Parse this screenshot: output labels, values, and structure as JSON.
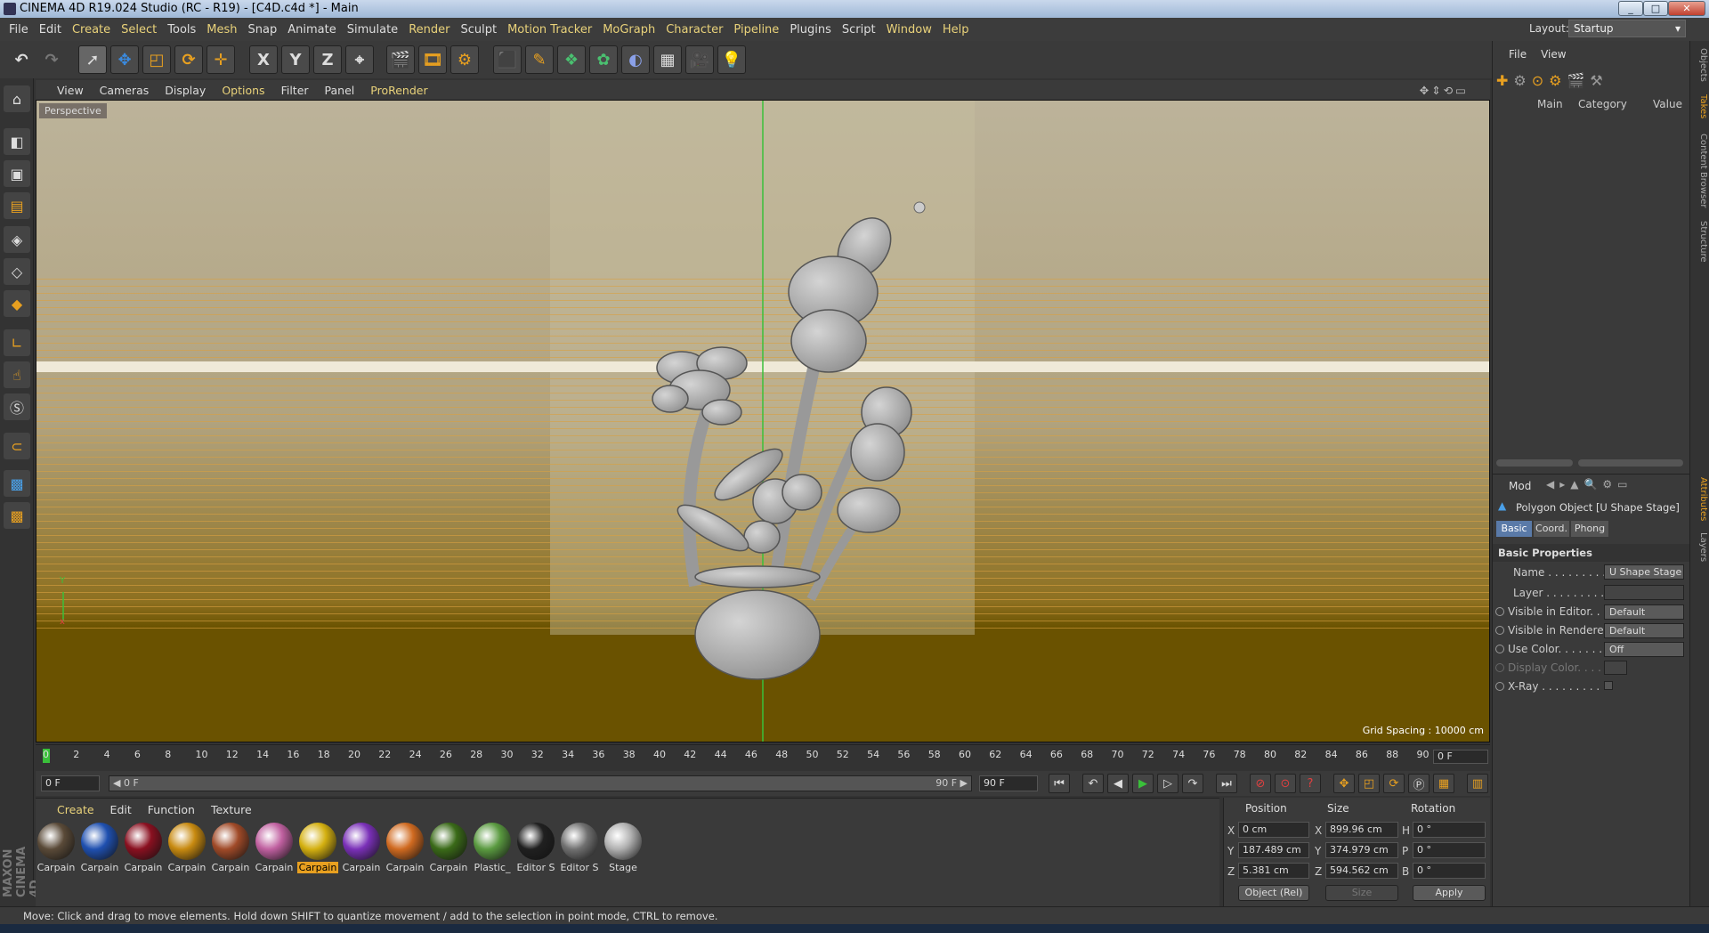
{
  "window": {
    "title": "CINEMA 4D R19.024 Studio (RC - R19) - [C4D.c4d *] - Main",
    "min": "_",
    "max": "□",
    "close": "✕"
  },
  "menu": [
    "File",
    "Edit",
    "Create",
    "Select",
    "Tools",
    "Mesh",
    "Snap",
    "Animate",
    "Simulate",
    "Render",
    "Sculpt",
    "Motion Tracker",
    "MoGraph",
    "Character",
    "Pipeline",
    "Plugins",
    "Script",
    "Window",
    "Help"
  ],
  "layout": {
    "label": "Layout:",
    "value": "Startup"
  },
  "toolbar": {
    "x": "X",
    "y": "Y",
    "z": "Z"
  },
  "viewport": {
    "menu": [
      "View",
      "Cameras",
      "Display",
      "Options",
      "Filter",
      "Panel",
      "ProRender"
    ],
    "camera_label": "Perspective",
    "grid_spacing": "Grid Spacing : 10000 cm",
    "axis_y": "Y",
    "axis_x": "x"
  },
  "timeline": {
    "ticks": [
      "0",
      "2",
      "4",
      "6",
      "8",
      "10",
      "12",
      "14",
      "16",
      "18",
      "20",
      "22",
      "24",
      "26",
      "28",
      "30",
      "32",
      "34",
      "36",
      "38",
      "40",
      "42",
      "44",
      "46",
      "48",
      "50",
      "52",
      "54",
      "56",
      "58",
      "60",
      "62",
      "64",
      "66",
      "68",
      "70",
      "72",
      "74",
      "76",
      "78",
      "80",
      "82",
      "84",
      "86",
      "88",
      "90"
    ],
    "current": "0 F"
  },
  "transport": {
    "start": "0 F",
    "range_start": "◀ 0 F",
    "range_end": "90 F ▶",
    "end": "90 F"
  },
  "materials": {
    "menu": [
      "Create",
      "Edit",
      "Function",
      "Texture"
    ],
    "items": [
      {
        "label": "Carpain",
        "color": "#5a4a38"
      },
      {
        "label": "Carpain",
        "color": "#1f50b0"
      },
      {
        "label": "Carpain",
        "color": "#8a1020"
      },
      {
        "label": "Carpain",
        "color": "#c88a10"
      },
      {
        "label": "Carpain",
        "color": "#a04a28"
      },
      {
        "label": "Carpain",
        "color": "#c060a0"
      },
      {
        "label": "Carpain",
        "color": "#d4b010",
        "selected": true
      },
      {
        "label": "Carpain",
        "color": "#7a30b8"
      },
      {
        "label": "Carpain",
        "color": "#d06a20"
      },
      {
        "label": "Carpain",
        "color": "#3a6a18"
      },
      {
        "label": "Plastic_",
        "color": "#5a9a40"
      },
      {
        "label": "Editor S",
        "color": "#202020"
      },
      {
        "label": "Editor S",
        "color": "#707070"
      },
      {
        "label": "Stage",
        "color": "#b0b0b0"
      }
    ]
  },
  "coords": {
    "headers": {
      "position": "Position",
      "size": "Size",
      "rotation": "Rotation"
    },
    "rows": [
      {
        "axis": "X",
        "pos": "0 cm",
        "saxis": "X",
        "size": "899.96 cm",
        "raxis": "H",
        "rot": "0 °"
      },
      {
        "axis": "Y",
        "pos": "187.489 cm",
        "saxis": "Y",
        "size": "374.979 cm",
        "raxis": "P",
        "rot": "0 °"
      },
      {
        "axis": "Z",
        "pos": "5.381 cm",
        "saxis": "Z",
        "size": "594.562 cm",
        "raxis": "B",
        "rot": "0 °"
      }
    ],
    "mode": "Object (Rel)",
    "size_mode": "Size",
    "apply": "Apply"
  },
  "objects": {
    "menu": [
      "File",
      "View"
    ],
    "cols": {
      "main": "Main",
      "category": "Category",
      "value": "Value"
    }
  },
  "attributes": {
    "mode": "Mod",
    "object_title": "Polygon Object [U Shape Stage]",
    "tabs": [
      "Basic",
      "Coord.",
      "Phong"
    ],
    "section": "Basic Properties",
    "rows": [
      {
        "label": "Name . . . . . . . . . .",
        "value": "U Shape Stage"
      },
      {
        "label": "Layer . . . . . . . . . .",
        "value": ""
      },
      {
        "label": "Visible in Editor. . .",
        "value": "Default"
      },
      {
        "label": "Visible in Renderer",
        "value": "Default"
      },
      {
        "label": "Use Color. . . . . . . .",
        "value": "Off"
      },
      {
        "label": "Display Color. . . .",
        "value": ""
      },
      {
        "label": "X-Ray . . . . . . . . . .",
        "value": ""
      }
    ]
  },
  "side_tabs": [
    "Objects",
    "Takes",
    "Content Browser",
    "Structure",
    "Attributes",
    "Layers"
  ],
  "status": "Move: Click and drag to move elements. Hold down SHIFT to quantize movement / add to the selection in point mode, CTRL to remove.",
  "brand": "MAXON CINEMA 4D"
}
